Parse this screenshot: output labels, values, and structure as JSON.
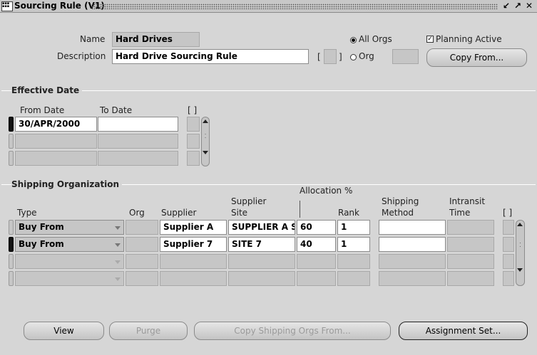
{
  "window": {
    "title": "Sourcing Rule (V1)"
  },
  "header": {
    "name_label": "Name",
    "name_value": "Hard Drives",
    "description_label": "Description",
    "description_value": "Hard Drive Sourcing Rule",
    "bracket_open": "[",
    "bracket_close": "]",
    "all_orgs_label": "All Orgs",
    "org_label": "Org",
    "planning_active_label": "Planning Active",
    "copy_from_label": "Copy From..."
  },
  "effective_date": {
    "section_title": "Effective Date",
    "from_date_header": "From Date",
    "to_date_header": "To Date",
    "dff_header": "[ ]",
    "rows": [
      {
        "from_date": "30/APR/2000",
        "to_date": ""
      },
      {
        "from_date": "",
        "to_date": ""
      },
      {
        "from_date": "",
        "to_date": ""
      }
    ]
  },
  "shipping_org": {
    "section_title": "Shipping Organization",
    "headers": {
      "type": "Type",
      "org": "Org",
      "supplier": "Supplier",
      "supplier_site_1": "Supplier",
      "supplier_site_2": "Site",
      "allocation": "Allocation %",
      "rank": "Rank",
      "shipping_method_1": "Shipping",
      "shipping_method_2": "Method",
      "intransit_1": "Intransit",
      "intransit_2": "Time",
      "dff": "[ ]"
    },
    "rows": [
      {
        "type": "Buy From",
        "org": "",
        "supplier": "Supplier A",
        "site": "SUPPLIER A S",
        "allocation": "60",
        "rank": "1",
        "method": "",
        "intransit": ""
      },
      {
        "type": "Buy From",
        "org": "",
        "supplier": "Supplier 7",
        "site": "SITE 7",
        "allocation": "40",
        "rank": "1",
        "method": "",
        "intransit": ""
      },
      {
        "type": "",
        "org": "",
        "supplier": "",
        "site": "",
        "allocation": "",
        "rank": "",
        "method": "",
        "intransit": ""
      },
      {
        "type": "",
        "org": "",
        "supplier": "",
        "site": "",
        "allocation": "",
        "rank": "",
        "method": "",
        "intransit": ""
      }
    ]
  },
  "buttons": {
    "view": "View",
    "purge": "Purge",
    "copy_shipping": "Copy Shipping Orgs From...",
    "assignment_set": "Assignment Set..."
  }
}
